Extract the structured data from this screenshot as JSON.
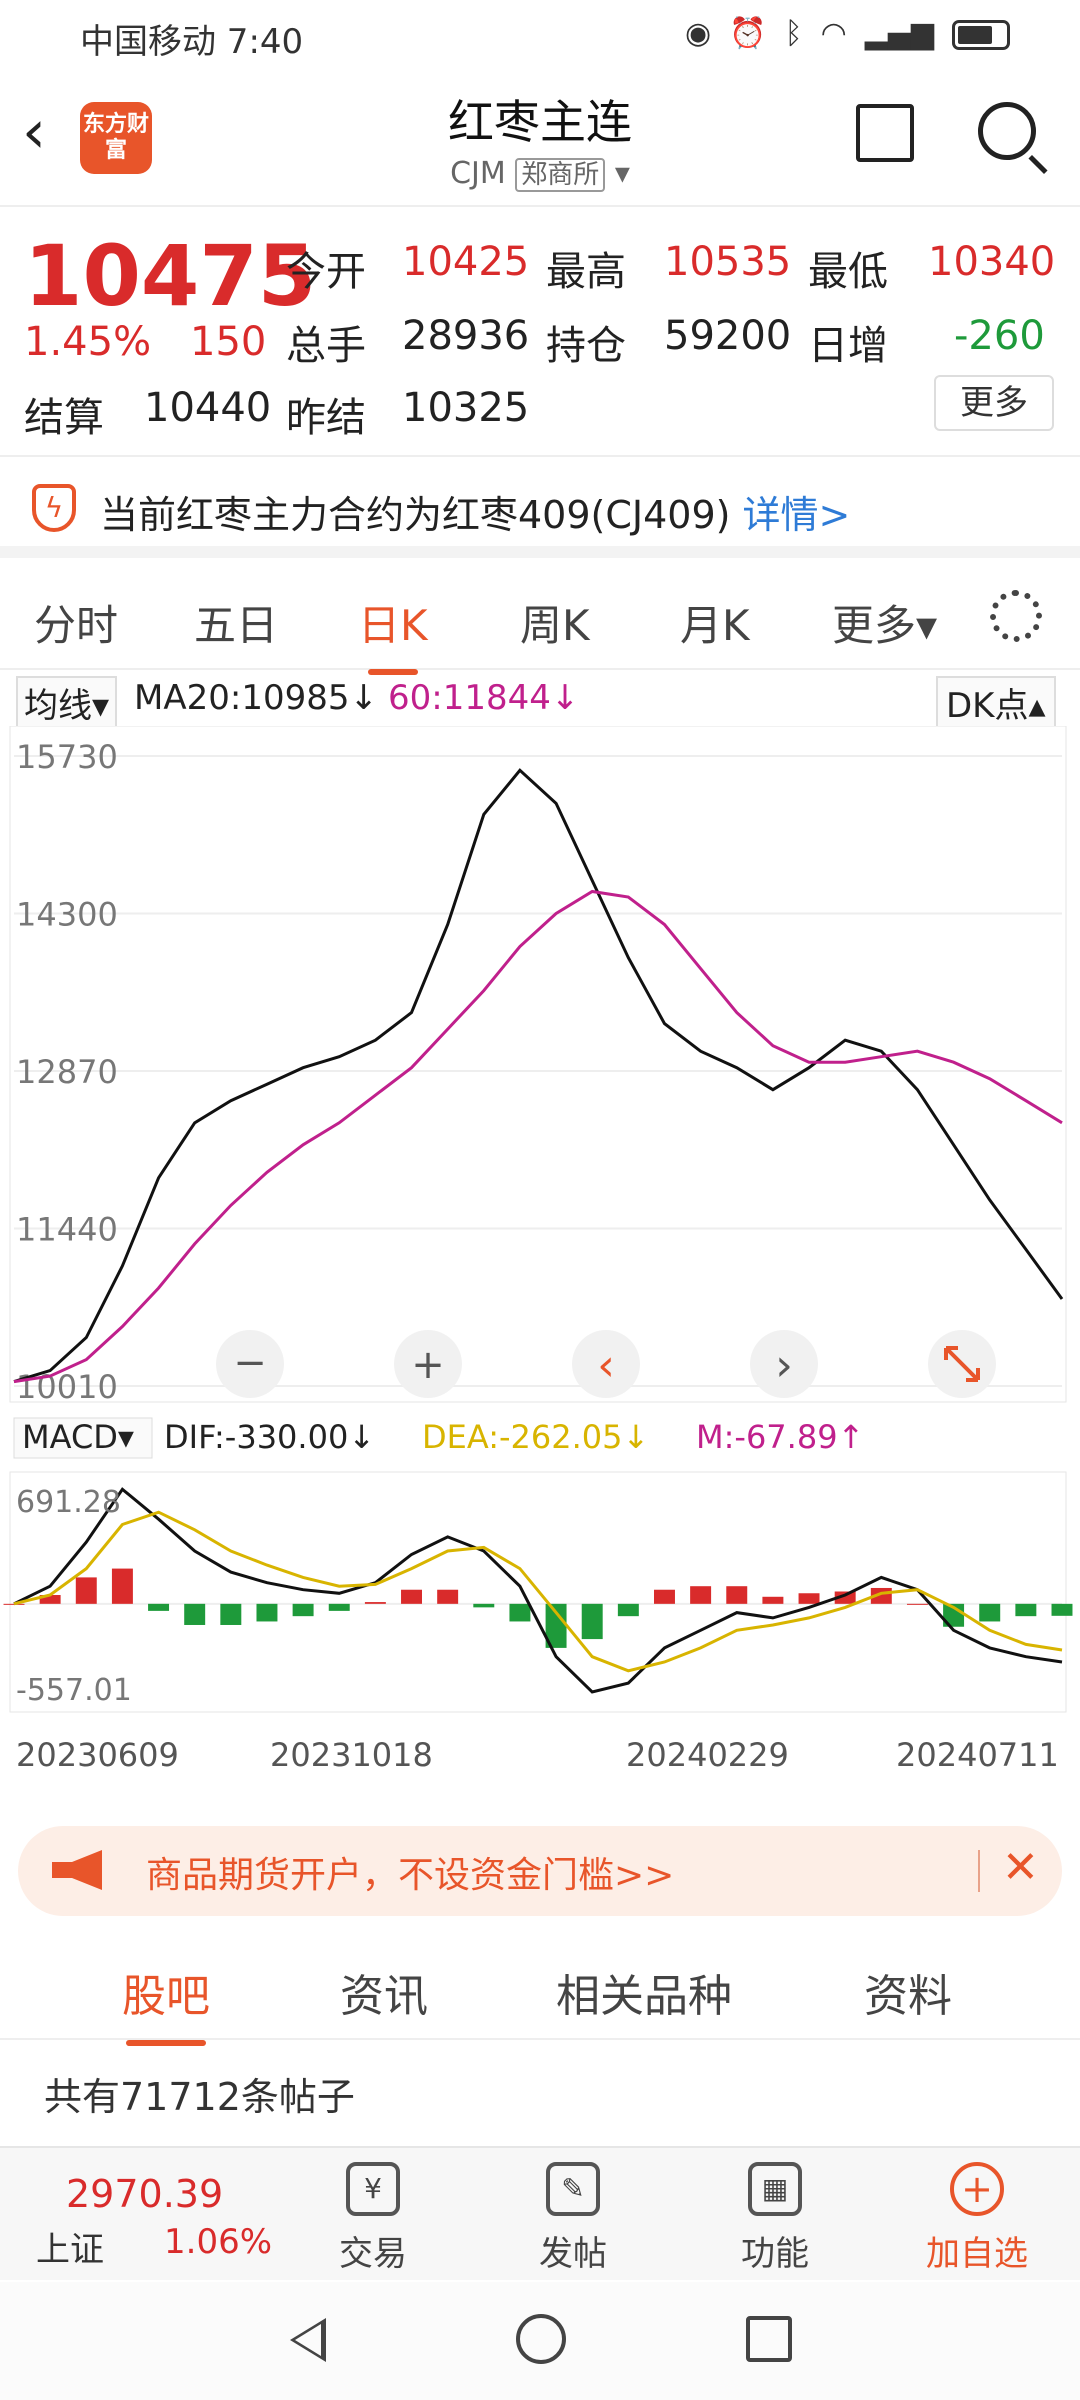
{
  "status": {
    "carrier": "中国移动 7:40",
    "icons": [
      "eye-icon",
      "alarm-icon",
      "bluetooth-icon",
      "vibrate-icon",
      "wifi-icon",
      "5g-signal-icon",
      "battery-icon"
    ]
  },
  "header": {
    "logo": "东方财富",
    "title": "红枣主连",
    "code": "CJM",
    "exchange": "郑商所"
  },
  "quote": {
    "price": "10475",
    "pct": "1.45%",
    "change": "150",
    "open_label": "今开",
    "open": "10425",
    "high_label": "最高",
    "high": "10535",
    "low_label": "最低",
    "low": "10340",
    "volume_label": "总手",
    "volume": "28936",
    "oi_label": "持仓",
    "oi": "59200",
    "daily_label": "日增",
    "daily": "-260",
    "settle_label": "结算",
    "settle": "10440",
    "prev_label": "昨结",
    "prev": "10325",
    "more": "更多"
  },
  "notice": {
    "text": "当前红枣主力合约为红枣409(CJ409)",
    "link": "详情>"
  },
  "tabs": [
    "分时",
    "五日",
    "日K",
    "周K",
    "月K",
    "更多▾"
  ],
  "ma": {
    "selector": "均线▾",
    "ma20": "MA20:10985↓",
    "ma60": "60:11844↓",
    "dk": "DK点▴"
  },
  "chart_data": {
    "type": "line",
    "price_axis": {
      "ticks": [
        "15730",
        "14300",
        "12870",
        "11440",
        "10010"
      ],
      "ylim": [
        10010,
        15730
      ]
    },
    "dates": [
      "20230609",
      "20231018",
      "20240229",
      "20240711"
    ],
    "series": [
      {
        "name": "MA20",
        "color": "#111111",
        "values": [
          10050,
          10150,
          10450,
          11100,
          11900,
          12400,
          12600,
          12750,
          12900,
          13000,
          13150,
          13400,
          14200,
          15200,
          15600,
          15300,
          14600,
          13900,
          13300,
          13050,
          12900,
          12700,
          12900,
          13150,
          13050,
          12700,
          12200,
          11700,
          11250,
          10800
        ]
      },
      {
        "name": "60",
        "color": "#c0208c",
        "values": [
          10050,
          10100,
          10250,
          10550,
          10900,
          11300,
          11650,
          11950,
          12200,
          12400,
          12650,
          12900,
          13250,
          13600,
          14000,
          14300,
          14500,
          14450,
          14200,
          13800,
          13400,
          13100,
          12950,
          12950,
          13000,
          13050,
          12950,
          12800,
          12600,
          12400
        ]
      }
    ],
    "macd": {
      "dif": "DIF:-330.00↓",
      "dea": "DEA:-262.05↓",
      "m": "M:-67.89↑",
      "ticks": [
        "691.28",
        "-557.01"
      ],
      "ylim": [
        -557.01,
        691.28
      ],
      "dif_values": [
        0,
        100,
        350,
        650,
        480,
        300,
        180,
        120,
        80,
        60,
        120,
        280,
        380,
        300,
        100,
        -300,
        -500,
        -450,
        -250,
        -150,
        -50,
        -80,
        -20,
        50,
        150,
        80,
        -150,
        -250,
        -300,
        -330
      ],
      "dea_values": [
        0,
        50,
        200,
        450,
        520,
        420,
        300,
        220,
        150,
        100,
        110,
        200,
        300,
        320,
        200,
        -50,
        -300,
        -380,
        -330,
        -250,
        -150,
        -120,
        -80,
        -20,
        60,
        80,
        -20,
        -150,
        -230,
        -262
      ],
      "m_values": [
        0,
        50,
        150,
        200,
        -40,
        -120,
        -120,
        -100,
        -70,
        -40,
        10,
        80,
        80,
        -20,
        -100,
        -250,
        -200,
        -70,
        80,
        100,
        100,
        40,
        60,
        70,
        90,
        0,
        -130,
        -100,
        -70,
        -68
      ]
    }
  },
  "chart_controls": {
    "minus": "−",
    "plus": "+",
    "prev": "‹",
    "next": "›"
  },
  "banner": {
    "text": "商品期货开户，不设资金门槛>>"
  },
  "subtabs": [
    "股吧",
    "资讯",
    "相关品种",
    "资料"
  ],
  "post_count": "共有71712条帖子",
  "index": {
    "value": "2970.39",
    "name": "上证",
    "pct": "1.06%"
  },
  "bottom_nav": [
    {
      "label": "交易",
      "icon": "yuan-exchange-icon",
      "glyph": "¥"
    },
    {
      "label": "发帖",
      "icon": "edit-icon",
      "glyph": "✎"
    },
    {
      "label": "功能",
      "icon": "grid-icon",
      "glyph": "▦"
    },
    {
      "label": "加自选",
      "icon": "add-icon",
      "glyph": "+"
    }
  ],
  "colors": {
    "accent": "#e8552a",
    "up": "#d92b2b",
    "down": "#1e9a3a"
  }
}
